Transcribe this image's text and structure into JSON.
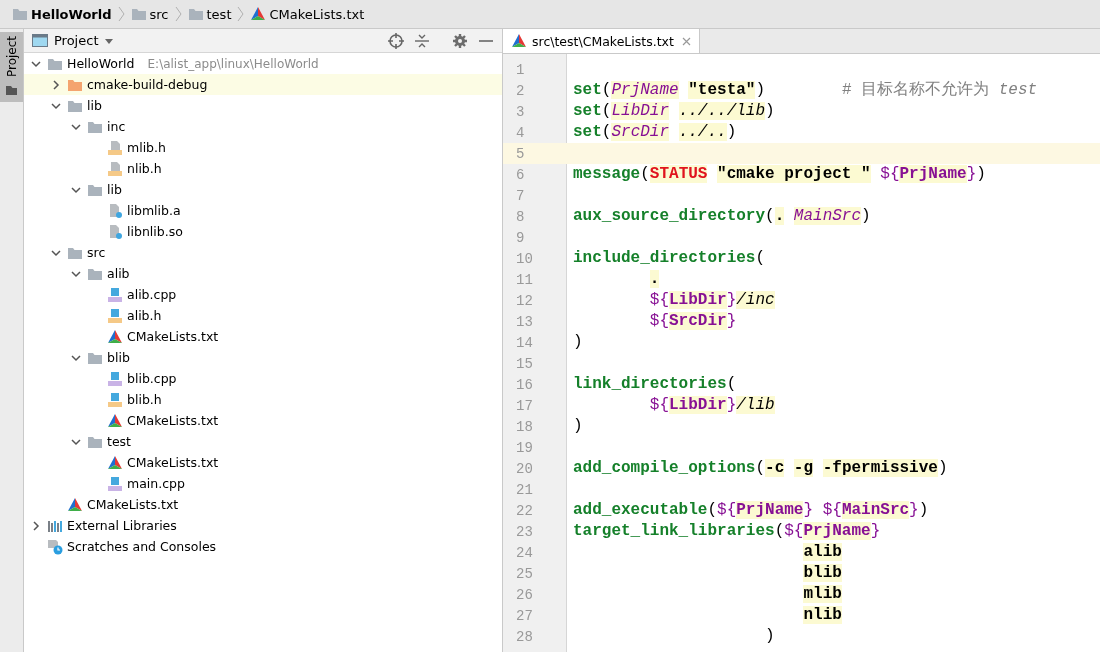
{
  "breadcrumb": [
    {
      "label": "HelloWorld",
      "kind": "folder"
    },
    {
      "label": "src",
      "kind": "folder"
    },
    {
      "label": "test",
      "kind": "folder"
    },
    {
      "label": "CMakeLists.txt",
      "kind": "cmake"
    }
  ],
  "tool_strip": {
    "tab": "Project",
    "selected": true
  },
  "project_panel": {
    "title": "Project",
    "tree": [
      {
        "label": "HelloWorld",
        "hint": "E:\\alist_app\\linux\\HelloWorld",
        "kind": "folder",
        "expanded": true,
        "selected": false,
        "children": [
          {
            "label": "cmake-build-debug",
            "kind": "folder-excluded",
            "expanded": false,
            "selected": true
          },
          {
            "label": "lib",
            "kind": "folder",
            "expanded": true,
            "selected": false,
            "children": [
              {
                "label": "inc",
                "kind": "folder",
                "expanded": true,
                "selected": false,
                "children": [
                  {
                    "label": "mlib.h",
                    "kind": "header",
                    "selected": false
                  },
                  {
                    "label": "nlib.h",
                    "kind": "header",
                    "selected": false
                  }
                ]
              },
              {
                "label": "lib",
                "kind": "folder",
                "expanded": true,
                "selected": false,
                "children": [
                  {
                    "label": "libmlib.a",
                    "kind": "unknown",
                    "selected": false
                  },
                  {
                    "label": "libnlib.so",
                    "kind": "unknown",
                    "selected": false
                  }
                ]
              }
            ]
          },
          {
            "label": "src",
            "kind": "folder",
            "expanded": true,
            "selected": false,
            "children": [
              {
                "label": "alib",
                "kind": "folder",
                "expanded": true,
                "selected": false,
                "children": [
                  {
                    "label": "alib.cpp",
                    "kind": "cpp",
                    "selected": false
                  },
                  {
                    "label": "alib.h",
                    "kind": "header-src",
                    "selected": false
                  },
                  {
                    "label": "CMakeLists.txt",
                    "kind": "cmake",
                    "selected": false
                  }
                ]
              },
              {
                "label": "blib",
                "kind": "folder",
                "expanded": true,
                "selected": false,
                "children": [
                  {
                    "label": "blib.cpp",
                    "kind": "cpp",
                    "selected": false
                  },
                  {
                    "label": "blib.h",
                    "kind": "header-src",
                    "selected": false
                  },
                  {
                    "label": "CMakeLists.txt",
                    "kind": "cmake",
                    "selected": false
                  }
                ]
              },
              {
                "label": "test",
                "kind": "folder",
                "expanded": true,
                "selected": false,
                "children": [
                  {
                    "label": "CMakeLists.txt",
                    "kind": "cmake",
                    "selected": false
                  },
                  {
                    "label": "main.cpp",
                    "kind": "cpp",
                    "selected": false
                  }
                ]
              }
            ]
          },
          {
            "label": "CMakeLists.txt",
            "kind": "cmake",
            "selected": false
          }
        ]
      },
      {
        "label": "External Libraries",
        "kind": "libraries",
        "expanded": false,
        "selected": false
      },
      {
        "label": "Scratches and Consoles",
        "kind": "scratches",
        "selected": false
      }
    ]
  },
  "editor": {
    "tabs": [
      {
        "label": "src\\test\\CMakeLists.txt",
        "kind": "cmake",
        "selected": true
      }
    ],
    "lines": [
      {
        "number": "1",
        "current": false
      },
      {
        "number": "2",
        "current": false,
        "tokens": [
          {
            "kind": "command",
            "text": "set"
          },
          {
            "kind": "paren",
            "text": "("
          },
          {
            "kind": "variable",
            "text": "PrjName"
          },
          {
            "kind": "string",
            "text": " \"testa\""
          },
          {
            "kind": "paren",
            "text": ")"
          },
          {
            "kind": "comment",
            "text": "        # 目标名称不允许为 "
          },
          {
            "kind": "comment-code",
            "text": "test"
          }
        ]
      },
      {
        "number": "3",
        "current": false,
        "tokens": [
          {
            "kind": "command",
            "text": "set"
          },
          {
            "kind": "paren",
            "text": "("
          },
          {
            "kind": "variable",
            "text": "LibDir"
          },
          {
            "kind": "path",
            "text": " ../../lib"
          },
          {
            "kind": "paren",
            "text": ")"
          }
        ]
      },
      {
        "number": "4",
        "current": false,
        "tokens": [
          {
            "kind": "command",
            "text": "set"
          },
          {
            "kind": "paren",
            "text": "("
          },
          {
            "kind": "variable",
            "text": "SrcDir"
          },
          {
            "kind": "path",
            "text": " ../.."
          },
          {
            "kind": "paren",
            "text": ")"
          }
        ]
      },
      {
        "number": "5",
        "current": true
      },
      {
        "number": "6",
        "current": false,
        "tokens": [
          {
            "kind": "command",
            "text": "message"
          },
          {
            "kind": "paren",
            "text": "("
          },
          {
            "kind": "keyword",
            "text": "STATUS"
          },
          {
            "kind": "string",
            "text": " \"cmake project \""
          },
          {
            "kind": "dollar",
            "text": " ${"
          },
          {
            "kind": "name",
            "text": "PrjName"
          },
          {
            "kind": "dollar",
            "text": "}"
          },
          {
            "kind": "paren",
            "text": ")"
          }
        ]
      },
      {
        "number": "7",
        "current": false
      },
      {
        "number": "8",
        "current": false,
        "tokens": [
          {
            "kind": "command",
            "text": "aux_source_directory"
          },
          {
            "kind": "paren",
            "text": "("
          },
          {
            "kind": "word",
            "text": "."
          },
          {
            "kind": "variable",
            "text": " MainSrc"
          },
          {
            "kind": "paren",
            "text": ")"
          }
        ]
      },
      {
        "number": "9",
        "current": false
      },
      {
        "number": "10",
        "current": false,
        "tokens": [
          {
            "kind": "command",
            "text": "include_directories"
          },
          {
            "kind": "paren",
            "text": "("
          }
        ]
      },
      {
        "number": "11",
        "current": false,
        "tokens": [
          {
            "kind": "word",
            "text": "        ."
          }
        ]
      },
      {
        "number": "12",
        "current": false,
        "tokens": [
          {
            "kind": "dollar",
            "text": "        ${"
          },
          {
            "kind": "name",
            "text": "LibDir"
          },
          {
            "kind": "dollar",
            "text": "}"
          },
          {
            "kind": "path",
            "text": "/inc"
          }
        ]
      },
      {
        "number": "13",
        "current": false,
        "tokens": [
          {
            "kind": "dollar",
            "text": "        ${"
          },
          {
            "kind": "name",
            "text": "SrcDir"
          },
          {
            "kind": "dollar",
            "text": "}"
          }
        ]
      },
      {
        "number": "14",
        "current": false,
        "tokens": [
          {
            "kind": "paren",
            "text": ")"
          }
        ]
      },
      {
        "number": "15",
        "current": false
      },
      {
        "number": "16",
        "current": false,
        "tokens": [
          {
            "kind": "command",
            "text": "link_directories"
          },
          {
            "kind": "paren",
            "text": "("
          }
        ]
      },
      {
        "number": "17",
        "current": false,
        "tokens": [
          {
            "kind": "dollar",
            "text": "        ${"
          },
          {
            "kind": "name",
            "text": "LibDir"
          },
          {
            "kind": "dollar",
            "text": "}"
          },
          {
            "kind": "path",
            "text": "/lib"
          }
        ]
      },
      {
        "number": "18",
        "current": false,
        "tokens": [
          {
            "kind": "paren",
            "text": ")"
          }
        ]
      },
      {
        "number": "19",
        "current": false
      },
      {
        "number": "20",
        "current": false,
        "tokens": [
          {
            "kind": "command",
            "text": "add_compile_options"
          },
          {
            "kind": "paren",
            "text": "("
          },
          {
            "kind": "word",
            "text": "-c"
          },
          {
            "kind": "word",
            "text": " -g"
          },
          {
            "kind": "word",
            "text": " -fpermissive"
          },
          {
            "kind": "paren",
            "text": ")"
          }
        ]
      },
      {
        "number": "21",
        "current": false
      },
      {
        "number": "22",
        "current": false,
        "tokens": [
          {
            "kind": "command",
            "text": "add_executable"
          },
          {
            "kind": "paren",
            "text": "("
          },
          {
            "kind": "dollar",
            "text": "${"
          },
          {
            "kind": "name",
            "text": "PrjName"
          },
          {
            "kind": "dollar",
            "text": "}"
          },
          {
            "kind": "dollar",
            "text": " ${"
          },
          {
            "kind": "name",
            "text": "MainSrc"
          },
          {
            "kind": "dollar",
            "text": "}"
          },
          {
            "kind": "paren",
            "text": ")"
          }
        ]
      },
      {
        "number": "23",
        "current": false,
        "tokens": [
          {
            "kind": "command",
            "text": "target_link_libraries"
          },
          {
            "kind": "paren",
            "text": "("
          },
          {
            "kind": "dollar",
            "text": "${"
          },
          {
            "kind": "name",
            "text": "PrjName"
          },
          {
            "kind": "dollar",
            "text": "}"
          }
        ]
      },
      {
        "number": "24",
        "current": false,
        "tokens": [
          {
            "kind": "word",
            "text": "                        alib"
          }
        ]
      },
      {
        "number": "25",
        "current": false,
        "tokens": [
          {
            "kind": "word",
            "text": "                        blib"
          }
        ]
      },
      {
        "number": "26",
        "current": false,
        "tokens": [
          {
            "kind": "word",
            "text": "                        mlib"
          }
        ]
      },
      {
        "number": "27",
        "current": false,
        "tokens": [
          {
            "kind": "word",
            "text": "                        nlib"
          }
        ]
      },
      {
        "number": "28",
        "current": false,
        "tokens": [
          {
            "kind": "paren",
            "text": "                    )"
          }
        ]
      }
    ]
  }
}
